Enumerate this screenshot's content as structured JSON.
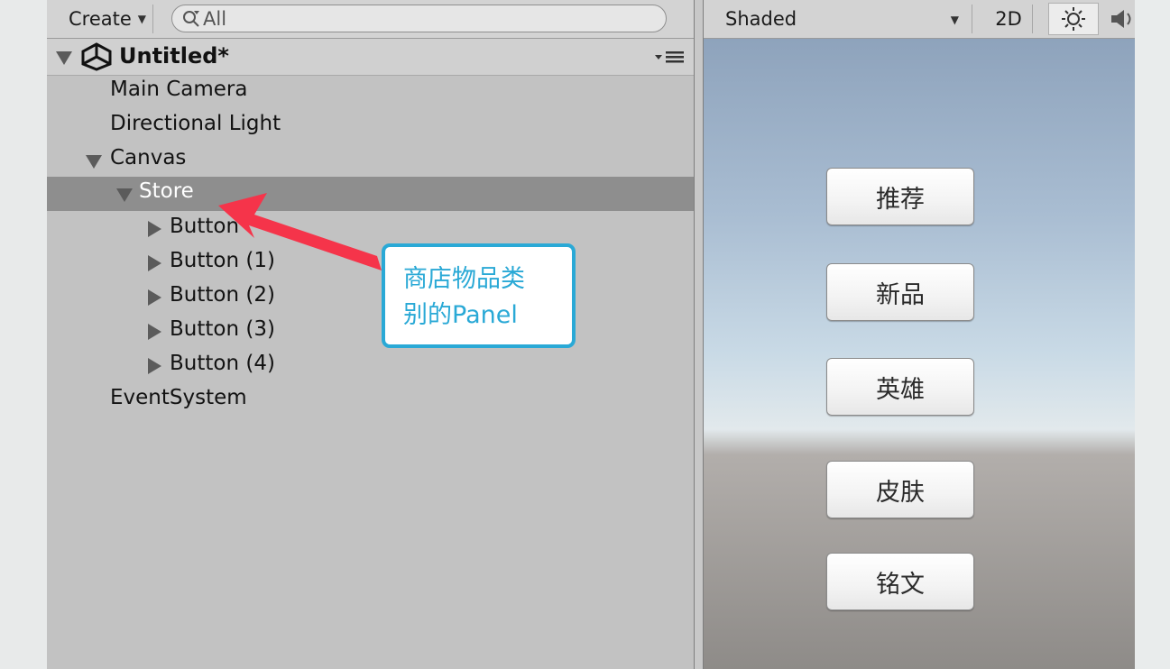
{
  "hierarchy": {
    "create_label": "Create",
    "search_placeholder": "All",
    "scene_name": "Untitled*",
    "items": [
      {
        "label": "Main Camera"
      },
      {
        "label": "Directional Light"
      },
      {
        "label": "Canvas"
      },
      {
        "label": "Store"
      },
      {
        "label": "Button"
      },
      {
        "label": "Button (1)"
      },
      {
        "label": "Button (2)"
      },
      {
        "label": "Button (3)"
      },
      {
        "label": "Button (4)"
      },
      {
        "label": "EventSystem"
      }
    ]
  },
  "scene_view": {
    "shading_mode": "Shaded",
    "mode_2d_label": "2D",
    "buttons": [
      {
        "label": "推荐"
      },
      {
        "label": "新品"
      },
      {
        "label": "英雄"
      },
      {
        "label": "皮肤"
      },
      {
        "label": "铭文"
      }
    ]
  },
  "annotation": {
    "line1": "商店物品类",
    "line2": "别的Panel",
    "arrow_color": "#f5344a",
    "box_color": "#2aa9d6"
  },
  "colors": {
    "selection": "#8e8e8e",
    "panel_bg": "#c2c2c2"
  }
}
